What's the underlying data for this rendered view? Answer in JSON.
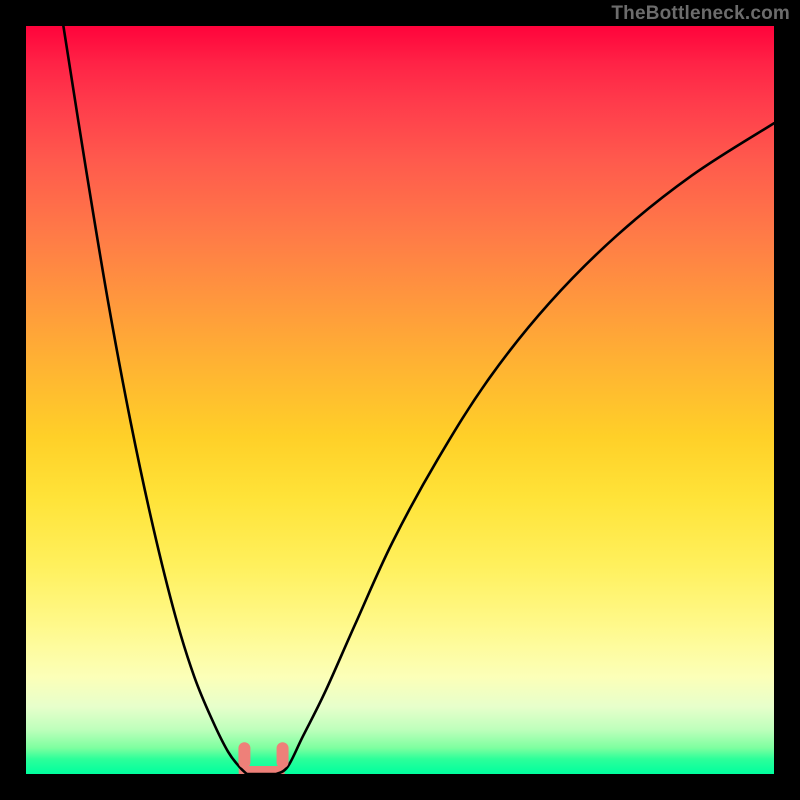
{
  "attribution": "TheBottleneck.com",
  "chart_data": {
    "type": "line",
    "title": "",
    "xlabel": "",
    "ylabel": "",
    "xlim": [
      0,
      100
    ],
    "ylim": [
      0,
      100
    ],
    "series": [
      {
        "name": "left-curve",
        "x": [
          5,
          8,
          11,
          14,
          17,
          20,
          22.5,
          25,
          27,
          28.5,
          29.5
        ],
        "values": [
          100,
          81,
          63,
          47,
          33,
          21,
          13,
          7,
          3,
          1,
          0
        ]
      },
      {
        "name": "right-curve",
        "x": [
          33.5,
          35,
          37,
          40,
          44,
          49,
          55,
          62,
          70,
          79,
          89,
          100
        ],
        "values": [
          0,
          1,
          5,
          11,
          20,
          31,
          42,
          53,
          63,
          72,
          80,
          87
        ]
      },
      {
        "name": "floor-segment",
        "x": [
          29.5,
          33.5
        ],
        "values": [
          0,
          0
        ]
      }
    ],
    "markers": [
      {
        "name": "marker-left",
        "x": 29.2,
        "y": 2.5,
        "color": "#ee8079"
      },
      {
        "name": "marker-right",
        "x": 34.3,
        "y": 2.5,
        "color": "#ee8079"
      }
    ],
    "floor_band": {
      "y_from": 0,
      "y_to": 0.8,
      "color": "#ee8079"
    }
  }
}
